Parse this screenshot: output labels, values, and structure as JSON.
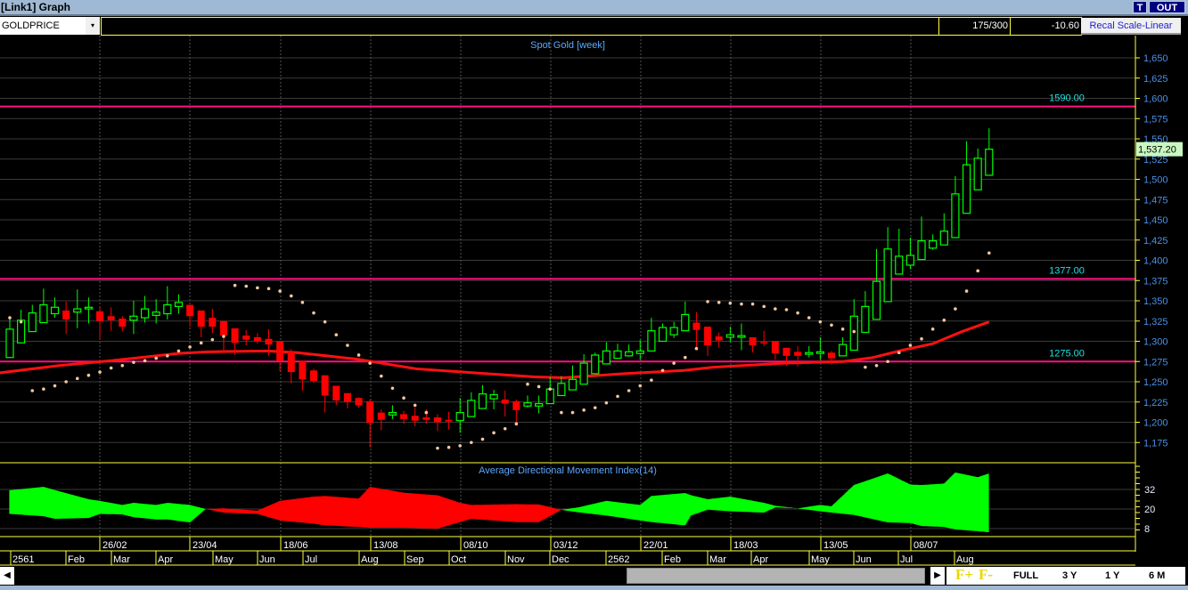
{
  "window": {
    "title": "[Link1] Graph",
    "t_button": "T",
    "out_button": "OUT"
  },
  "toolbar": {
    "symbol": "GOLDPRICE",
    "dropdown_arrow": "▾",
    "count": "175/300",
    "change": "-10.60",
    "recal_button": "Recal Scale-Linear"
  },
  "colors": {
    "up": "#00ff00",
    "down": "#ff0000",
    "ma": "#ff1010",
    "hline": "#ff1080",
    "sar": "#f0c8a0",
    "axis": "#ffff40",
    "tick_text": "#4a90e8",
    "level_text": "#20e0e0",
    "title_text": "#5aa8ff"
  },
  "chart_data": [
    {
      "type": "candlestick",
      "title": "Spot Gold [week]",
      "ylim": [
        1150,
        1675
      ],
      "yticks": [
        "1,175",
        "1,200",
        "1,225",
        "1,250",
        "1,275",
        "1,300",
        "1,325",
        "1,350",
        "1,375",
        "1,400",
        "1,425",
        "1,450",
        "1,475",
        "1,500",
        "1,525",
        "1,550",
        "1,575",
        "1,600",
        "1,625",
        "1,650"
      ],
      "ytick_values": [
        1175,
        1200,
        1225,
        1250,
        1275,
        1300,
        1325,
        1350,
        1375,
        1400,
        1425,
        1450,
        1475,
        1500,
        1525,
        1550,
        1575,
        1600,
        1625,
        1650
      ],
      "last_price_label": "1,537.20",
      "last_price": 1537.2,
      "levels": [
        {
          "value": 1590,
          "label": "1590.00"
        },
        {
          "value": 1377,
          "label": "1377.00"
        },
        {
          "value": 1275,
          "label": "1275.00"
        }
      ],
      "ohlc": [
        [
          1280,
          1329,
          1280,
          1315
        ],
        [
          1298,
          1339,
          1298,
          1326
        ],
        [
          1312,
          1345,
          1312,
          1335
        ],
        [
          1323,
          1365,
          1323,
          1345
        ],
        [
          1334,
          1354,
          1329,
          1342
        ],
        [
          1338,
          1349,
          1309,
          1327
        ],
        [
          1336,
          1364,
          1316,
          1340
        ],
        [
          1340,
          1354,
          1322,
          1342
        ],
        [
          1337,
          1343,
          1303,
          1325
        ],
        [
          1331,
          1342,
          1313,
          1326
        ],
        [
          1328,
          1331,
          1312,
          1318
        ],
        [
          1326,
          1350,
          1309,
          1331
        ],
        [
          1329,
          1356,
          1323,
          1340
        ],
        [
          1332,
          1352,
          1322,
          1336
        ],
        [
          1334,
          1368,
          1327,
          1345
        ],
        [
          1343,
          1358,
          1334,
          1348
        ],
        [
          1345,
          1345,
          1318,
          1331
        ],
        [
          1338,
          1338,
          1305,
          1318
        ],
        [
          1329,
          1340,
          1310,
          1318
        ],
        [
          1325,
          1325,
          1286,
          1307
        ],
        [
          1316,
          1316,
          1283,
          1298
        ],
        [
          1307,
          1314,
          1295,
          1302
        ],
        [
          1305,
          1310,
          1297,
          1300
        ],
        [
          1303,
          1315,
          1282,
          1296
        ],
        [
          1300,
          1300,
          1263,
          1276
        ],
        [
          1287,
          1290,
          1248,
          1262
        ],
        [
          1276,
          1276,
          1239,
          1253
        ],
        [
          1264,
          1266,
          1249,
          1251
        ],
        [
          1258,
          1258,
          1212,
          1233
        ],
        [
          1245,
          1245,
          1221,
          1227
        ],
        [
          1236,
          1236,
          1217,
          1225
        ],
        [
          1230,
          1231,
          1218,
          1221
        ],
        [
          1226,
          1228,
          1169,
          1199
        ],
        [
          1212,
          1216,
          1190,
          1203
        ],
        [
          1209,
          1221,
          1204,
          1212
        ],
        [
          1210,
          1214,
          1198,
          1204
        ],
        [
          1208,
          1218,
          1195,
          1202
        ],
        [
          1206,
          1216,
          1198,
          1203
        ],
        [
          1206,
          1210,
          1189,
          1200
        ],
        [
          1203,
          1213,
          1191,
          1201
        ],
        [
          1202,
          1230,
          1187,
          1212
        ],
        [
          1207,
          1237,
          1207,
          1227
        ],
        [
          1217,
          1246,
          1217,
          1235
        ],
        [
          1229,
          1240,
          1216,
          1234
        ],
        [
          1228,
          1239,
          1207,
          1223
        ],
        [
          1226,
          1228,
          1200,
          1215
        ],
        [
          1220,
          1233,
          1218,
          1224
        ],
        [
          1220,
          1233,
          1211,
          1223
        ],
        [
          1223,
          1256,
          1223,
          1241
        ],
        [
          1233,
          1257,
          1233,
          1248
        ],
        [
          1240,
          1270,
          1240,
          1253
        ],
        [
          1247,
          1284,
          1247,
          1273
        ],
        [
          1260,
          1286,
          1260,
          1283
        ],
        [
          1272,
          1299,
          1272,
          1288
        ],
        [
          1279,
          1297,
          1279,
          1288
        ],
        [
          1282,
          1296,
          1281,
          1287
        ],
        [
          1285,
          1302,
          1277,
          1288
        ],
        [
          1288,
          1329,
          1288,
          1313
        ],
        [
          1300,
          1322,
          1300,
          1317
        ],
        [
          1308,
          1324,
          1304,
          1317
        ],
        [
          1313,
          1349,
          1313,
          1333
        ],
        [
          1323,
          1336,
          1292,
          1314
        ],
        [
          1318,
          1318,
          1282,
          1295
        ],
        [
          1306,
          1311,
          1292,
          1301
        ],
        [
          1305,
          1318,
          1299,
          1308
        ],
        [
          1305,
          1322,
          1289,
          1307
        ],
        [
          1305,
          1305,
          1286,
          1295
        ],
        [
          1299,
          1313,
          1294,
          1298
        ],
        [
          1300,
          1300,
          1277,
          1285
        ],
        [
          1292,
          1292,
          1270,
          1282
        ],
        [
          1287,
          1294,
          1269,
          1282
        ],
        [
          1284,
          1294,
          1280,
          1286
        ],
        [
          1285,
          1305,
          1277,
          1287
        ],
        [
          1286,
          1288,
          1271,
          1279
        ],
        [
          1282,
          1305,
          1282,
          1296
        ],
        [
          1289,
          1352,
          1289,
          1331
        ],
        [
          1311,
          1362,
          1311,
          1343
        ],
        [
          1327,
          1414,
          1327,
          1374
        ],
        [
          1349,
          1441,
          1349,
          1414
        ],
        [
          1383,
          1439,
          1383,
          1405
        ],
        [
          1394,
          1428,
          1389,
          1406
        ],
        [
          1401,
          1454,
          1401,
          1424
        ],
        [
          1415,
          1432,
          1413,
          1424
        ],
        [
          1419,
          1458,
          1419,
          1436
        ],
        [
          1428,
          1504,
          1428,
          1482
        ],
        [
          1458,
          1547,
          1458,
          1518
        ],
        [
          1487,
          1538,
          1487,
          1526
        ],
        [
          1505,
          1563,
          1505,
          1537.2
        ]
      ],
      "sar": [
        1329,
        1324,
        1239,
        1241,
        1245,
        1250,
        1254,
        1258,
        1262,
        1267,
        1270,
        1274,
        1276,
        1279,
        1282,
        1288,
        1293,
        1298,
        1302,
        1306,
        1369,
        1368,
        1366,
        1365,
        1362,
        1356,
        1348,
        1335,
        1324,
        1308,
        1295,
        1283,
        1273,
        1257,
        1242,
        1230,
        1221,
        1212,
        1168,
        1169,
        1171,
        1175,
        1179,
        1187,
        1192,
        1198,
        1247,
        1244,
        1241,
        1212,
        1212,
        1215,
        1218,
        1224,
        1232,
        1239,
        1245,
        1252,
        1264,
        1273,
        1280,
        1291,
        1349,
        1348,
        1347,
        1346,
        1346,
        1343,
        1340,
        1339,
        1335,
        1329,
        1324,
        1320,
        1315,
        1312,
        1268,
        1270,
        1275,
        1286,
        1295,
        1303,
        1315,
        1326,
        1340,
        1362,
        1387,
        1409
      ],
      "moving_average": [
        [
          0.1,
          1261
        ],
        [
          5.4,
          1270
        ],
        [
          10.7,
          1277
        ],
        [
          16,
          1285
        ],
        [
          18.6,
          1287
        ],
        [
          23.9,
          1288
        ],
        [
          26.5,
          1286
        ],
        [
          31.8,
          1278
        ],
        [
          37.1,
          1266
        ],
        [
          42.3,
          1261
        ],
        [
          47.6,
          1256
        ],
        [
          50.2,
          1255
        ],
        [
          55.6,
          1260
        ],
        [
          60.9,
          1264
        ],
        [
          63.5,
          1268
        ],
        [
          69.8,
          1273
        ],
        [
          75.1,
          1275
        ],
        [
          77.7,
          1280
        ],
        [
          80.3,
          1289
        ],
        [
          83,
          1297
        ],
        [
          85.6,
          1312
        ],
        [
          88,
          1324
        ]
      ]
    },
    {
      "type": "area",
      "title": "Average Directional Movement Index(14)",
      "ylim": [
        3,
        48
      ],
      "yticks": [
        "8",
        "20",
        "32"
      ],
      "ytick_values": [
        8,
        20,
        32
      ],
      "dmi": [
        [
          1,
          31.5,
          17
        ],
        [
          4,
          33.6,
          15.6
        ],
        [
          5,
          31.6,
          14
        ],
        [
          8,
          26,
          14.5
        ],
        [
          9,
          25,
          17
        ],
        [
          11,
          22.5,
          16.7
        ],
        [
          12,
          23.8,
          15
        ],
        [
          14,
          22.5,
          13.6
        ],
        [
          15,
          23.8,
          13.6
        ],
        [
          17,
          22.5,
          11.8
        ],
        [
          18.4,
          20,
          20
        ],
        [
          20,
          17.8,
          20.4
        ],
        [
          23,
          17,
          19
        ],
        [
          25,
          13,
          25
        ],
        [
          28,
          11,
          27.6
        ],
        [
          29,
          10,
          28
        ],
        [
          32,
          9,
          26.4
        ],
        [
          33,
          8.5,
          33.6
        ],
        [
          36,
          8.5,
          30
        ],
        [
          39,
          8,
          28.4
        ],
        [
          41,
          12,
          23.8
        ],
        [
          42,
          14,
          22.5
        ],
        [
          46,
          12,
          23
        ],
        [
          48,
          12,
          22.8
        ],
        [
          50,
          19.5,
          19.5
        ],
        [
          51.5,
          21,
          18
        ],
        [
          54,
          25,
          16
        ],
        [
          57,
          22.5,
          13
        ],
        [
          58,
          28,
          12
        ],
        [
          61,
          29.8,
          10
        ],
        [
          61.5,
          28.5,
          16
        ],
        [
          63,
          26,
          19.6
        ],
        [
          65,
          27.6,
          18.6
        ],
        [
          68,
          23.8,
          17.8
        ],
        [
          69,
          22,
          21
        ],
        [
          71,
          20.4,
          20.4
        ],
        [
          73,
          22.5,
          18.6
        ],
        [
          74,
          21.7,
          17.8
        ],
        [
          76,
          34.7,
          16.4
        ],
        [
          79,
          41.8,
          11.8
        ],
        [
          81,
          35,
          11.4
        ],
        [
          82,
          34.7,
          9.6
        ],
        [
          84,
          35.6,
          9
        ],
        [
          85,
          42.4,
          7.5
        ],
        [
          87,
          39.5,
          6.4
        ],
        [
          88,
          41.8,
          5.8
        ]
      ]
    }
  ],
  "time_axis": {
    "dates": [
      "26/02",
      "23/04",
      "18/06",
      "13/08",
      "08/10",
      "03/12",
      "22/01",
      "18/03",
      "13/05",
      "08/07"
    ],
    "months": [
      "2561",
      "Feb",
      "Mar",
      "Apr",
      "May",
      "Jun",
      "Jul",
      "Aug",
      "Sep",
      "Oct",
      "Nov",
      "Dec",
      "2562",
      "Feb",
      "Mar",
      "Apr",
      "May",
      "Jun",
      "Jul",
      "Aug"
    ]
  },
  "scrollbar": {
    "left_arrow": "◀",
    "right_arrow": "▶"
  },
  "zoom_buttons": {
    "f_plus": "F+",
    "f_minus": "F-",
    "full": "FULL",
    "y3": "3 Y",
    "y1": "1 Y",
    "m6": "6 M"
  }
}
